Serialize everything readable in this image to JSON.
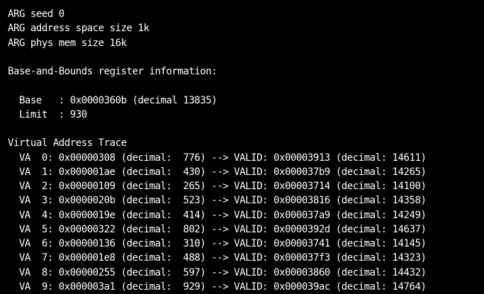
{
  "terminal": {
    "lines": [
      "ARG seed 0",
      "ARG address space size 1k",
      "ARG phys mem size 16k",
      "",
      "Base-and-Bounds register information:",
      "",
      "  Base   : 0x0000360b (decimal 13835)",
      "  Limit  : 930",
      "",
      "Virtual Address Trace",
      "  VA  0: 0x00000308 (decimal:  776) --> VALID: 0x00003913 (decimal: 14611)",
      "  VA  1: 0x000001ae (decimal:  430) --> VALID: 0x000037b9 (decimal: 14265)",
      "  VA  2: 0x00000109 (decimal:  265) --> VALID: 0x00003714 (decimal: 14100)",
      "  VA  3: 0x0000020b (decimal:  523) --> VALID: 0x00003816 (decimal: 14358)",
      "  VA  4: 0x0000019e (decimal:  414) --> VALID: 0x000037a9 (decimal: 14249)",
      "  VA  5: 0x00000322 (decimal:  802) --> VALID: 0x0000392d (decimal: 14637)",
      "  VA  6: 0x00000136 (decimal:  310) --> VALID: 0x00003741 (decimal: 14145)",
      "  VA  7: 0x000001e8 (decimal:  488) --> VALID: 0x000037f3 (decimal: 14323)",
      "  VA  8: 0x00000255 (decimal:  597) --> VALID: 0x00003860 (decimal: 14432)",
      "  VA  9: 0x000003a1 (decimal:  929) --> VALID: 0x000039ac (decimal: 14764)"
    ]
  },
  "colors": {
    "background": "#000000",
    "foreground": "#ffffff"
  }
}
